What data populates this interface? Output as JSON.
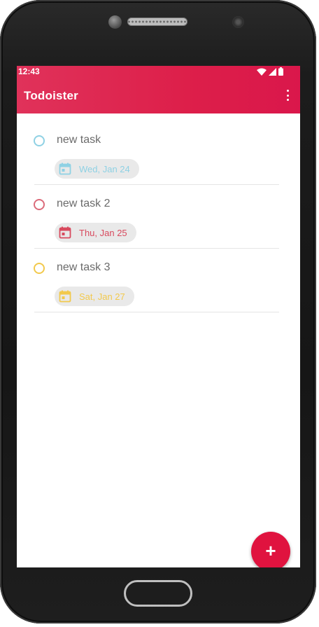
{
  "status_bar": {
    "time": "12:43",
    "icons": [
      "wifi-icon",
      "signal-icon",
      "battery-icon"
    ]
  },
  "app_bar": {
    "title": "Todoister",
    "menu_icon": "more-vert-icon",
    "color": "#dd1f4a"
  },
  "tasks": [
    {
      "title": "new task",
      "date": "Wed, Jan 24",
      "color": "#8fd1e4",
      "date_color": "#8fd1e4",
      "icon": "calendar-icon"
    },
    {
      "title": "new task 2",
      "date": "Thu, Jan 25",
      "color": "#db6b7a",
      "date_color": "#d84a5e",
      "icon": "calendar-icon"
    },
    {
      "title": "new task 3",
      "date": "Sat, Jan 27",
      "color": "#f2c94c",
      "date_color": "#f2c94c",
      "icon": "calendar-icon"
    }
  ],
  "fab": {
    "label": "+",
    "icon": "add-icon",
    "color": "#e0133f"
  }
}
